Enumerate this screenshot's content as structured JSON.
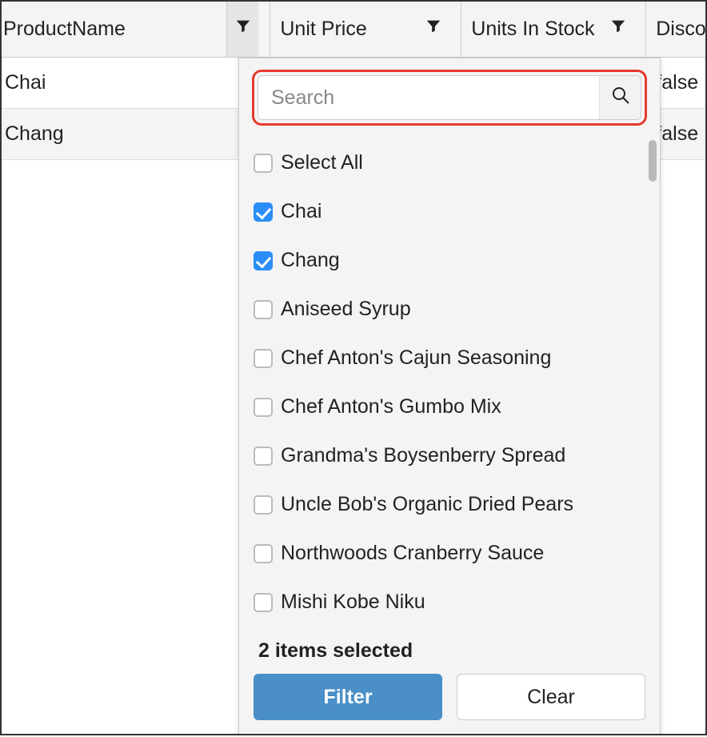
{
  "columns": {
    "productName": "ProductName",
    "unitPrice": "Unit Price",
    "unitsInStock": "Units In Stock",
    "discontinued": "Discontinued"
  },
  "rows": [
    {
      "productName": "Chai",
      "discontinued": "false"
    },
    {
      "productName": "Chang",
      "discontinued": "false"
    }
  ],
  "filter": {
    "searchPlaceholder": "Search",
    "selectAllLabel": "Select All",
    "options": [
      {
        "label": "Chai",
        "checked": true
      },
      {
        "label": "Chang",
        "checked": true
      },
      {
        "label": "Aniseed Syrup",
        "checked": false
      },
      {
        "label": "Chef Anton's Cajun Seasoning",
        "checked": false
      },
      {
        "label": "Chef Anton's Gumbo Mix",
        "checked": false
      },
      {
        "label": "Grandma's Boysenberry Spread",
        "checked": false
      },
      {
        "label": "Uncle Bob's Organic Dried Pears",
        "checked": false
      },
      {
        "label": "Northwoods Cranberry Sauce",
        "checked": false
      },
      {
        "label": "Mishi Kobe Niku",
        "checked": false
      }
    ],
    "selectedText": "2 items selected",
    "filterLabel": "Filter",
    "clearLabel": "Clear"
  }
}
